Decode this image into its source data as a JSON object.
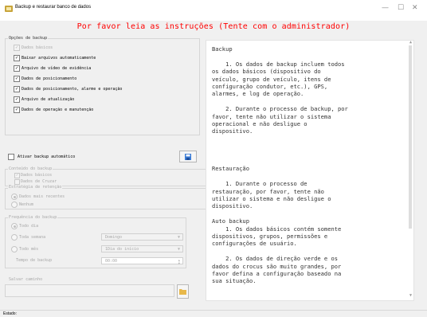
{
  "window": {
    "title": "Backup e restaurar banco de dados"
  },
  "banner": "Por favor leia as instruções (Tente com o administrador)",
  "backup_options": {
    "title": "Opções de backup",
    "items": [
      {
        "label": "Dados básicos",
        "checked": true,
        "disabled": true
      },
      {
        "label": "Baixar arquivos automaticamente",
        "checked": true,
        "disabled": false
      },
      {
        "label": "Arquivo de vídeo de evidência",
        "checked": true,
        "disabled": false
      },
      {
        "label": "Dados de posicionamento",
        "checked": true,
        "disabled": false
      },
      {
        "label": "Dados de posicionamento, alarme e operação",
        "checked": true,
        "disabled": false
      },
      {
        "label": "Arquivo de atualização",
        "checked": true,
        "disabled": false
      },
      {
        "label": "Dados de operação e manutenção",
        "checked": true,
        "disabled": false
      }
    ]
  },
  "auto_backup": {
    "label": "Ativar backup automático",
    "checked": false
  },
  "backup_content": {
    "title": "Conteúdo do backup",
    "items": [
      {
        "label": "Dados básicos",
        "checked": true
      },
      {
        "label": "Dados de Cruzar",
        "checked": false
      }
    ]
  },
  "retention": {
    "title": "Estratégia de retenção",
    "options": [
      {
        "label": "Dados mais recentes",
        "selected": true
      },
      {
        "label": "Nenhum",
        "selected": false
      }
    ]
  },
  "frequency": {
    "title": "Frequência do backup",
    "options": [
      {
        "label": "Todo dia",
        "selected": true
      },
      {
        "label": "Toda semana",
        "selected": false
      },
      {
        "label": "Todo mês",
        "selected": false
      }
    ],
    "week_value": "Domingo",
    "month_value": "1Dia do início",
    "time_label": "Tempo de backup",
    "time_value": "00:00"
  },
  "path": {
    "title": "Salvar caminho",
    "value": ""
  },
  "instructions": {
    "lines": [
      "Backup",
      "",
      "    1. Os dados de backup incluem todos",
      "os dados básicos (dispositivo do",
      "veículo, grupo de veículo, itens de",
      "configuração condutor, etc.), GPS,",
      "alarmes, e log de operação.",
      "",
      "    2. Durante o processo de backup, por",
      "favor, tente não utilizar o sistema",
      "operacional e não desligue o",
      "dispositivo.",
      "",
      "",
      "",
      "",
      "Restauração",
      "",
      "    1. Durante o processo de",
      "restauração, por favor, tente não",
      "utilizar o sistema e não desligue o",
      "dispositivo.",
      "",
      "Auto backup",
      "    1. Os dados básicos contém somente",
      "dispositivos, grupos, permissões e",
      "configurações de usuário.",
      "",
      "    2. Os dados de direção verde e os",
      "dados do crocus são muito grandes, por",
      "favor defina a configuração baseado na",
      "sua situação."
    ]
  },
  "status": {
    "label": "Estado:"
  },
  "colors": {
    "banner": "#ff0000",
    "save_icon": "#3a7bd5"
  }
}
